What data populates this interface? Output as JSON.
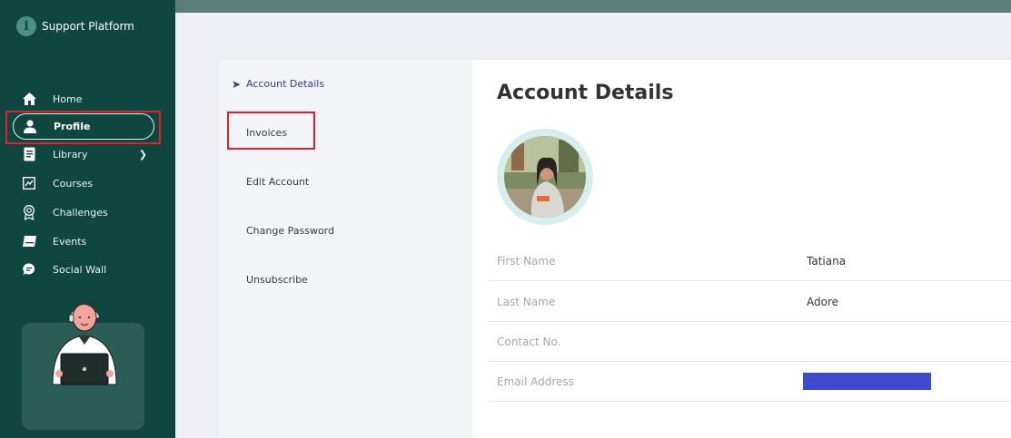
{
  "brand": {
    "name": "Support Platform",
    "logo_glyph": "i"
  },
  "nav": {
    "items": [
      {
        "label": "Home",
        "icon": "home-icon"
      },
      {
        "label": "Profile",
        "icon": "user-icon"
      },
      {
        "label": "Library",
        "icon": "book-icon"
      },
      {
        "label": "Courses",
        "icon": "chart-icon"
      },
      {
        "label": "Challenges",
        "icon": "medal-icon"
      },
      {
        "label": "Events",
        "icon": "ticket-icon"
      },
      {
        "label": "Social Wall",
        "icon": "chat-bubble-icon"
      }
    ],
    "active": "Profile"
  },
  "account_menu": {
    "items": [
      {
        "label": "Account Details"
      },
      {
        "label": "Invoices"
      },
      {
        "label": "Edit Account"
      },
      {
        "label": "Change Password"
      },
      {
        "label": "Unsubscribe"
      }
    ],
    "active": "Account Details"
  },
  "details": {
    "title": "Account Details",
    "fields": [
      {
        "label": "First Name",
        "value": "Tatiana"
      },
      {
        "label": "Last Name",
        "value": "Adore"
      },
      {
        "label": "Contact No.",
        "value": ""
      },
      {
        "label": "Email Address",
        "value": ""
      }
    ]
  },
  "colors": {
    "sidebar": "#0f463f",
    "accent": "#2f3e8f",
    "highlight": "#e0202b",
    "redaction": "#3d4bcc"
  }
}
